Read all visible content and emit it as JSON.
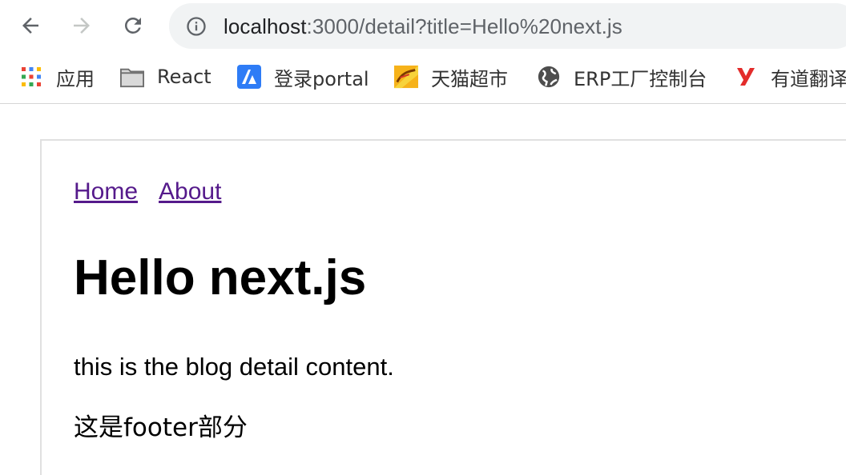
{
  "browser": {
    "url_host": "localhost",
    "url_rest": ":3000/detail?title=Hello%20next.js",
    "bookmarks": [
      {
        "label": "应用",
        "icon": "apps-grid-icon"
      },
      {
        "label": "React",
        "icon": "folder-icon"
      },
      {
        "label": "登录portal",
        "icon": "portal-logo-icon"
      },
      {
        "label": "天猫超市",
        "icon": "tmall-icon"
      },
      {
        "label": "ERP工厂控制台",
        "icon": "globe-icon"
      },
      {
        "label": "有道翻译",
        "icon": "youdao-icon"
      }
    ]
  },
  "page": {
    "nav": {
      "home": "Home",
      "about": "About"
    },
    "title": "Hello next.js",
    "content": "this is the blog detail content.",
    "footer": "这是footer部分"
  }
}
